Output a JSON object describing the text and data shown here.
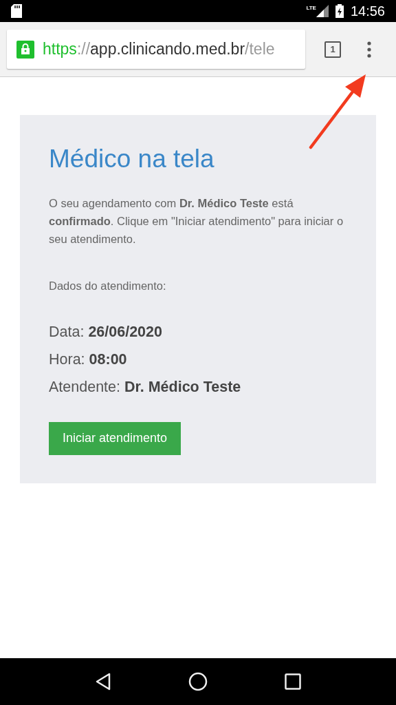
{
  "status_bar": {
    "network": "LTE",
    "time": "14:56"
  },
  "browser": {
    "url": {
      "scheme": "https",
      "separator": "://",
      "host": "app.clinicando.med.br",
      "path": "/tele"
    },
    "tab_count": "1"
  },
  "card": {
    "title": "Médico na tela",
    "message": "O seu agendamento com **Dr. Médico Teste** está **confirmado**. Clique em \"Iniciar atendimento\" para iniciar o seu atendimento.",
    "details_heading": "Dados do atendimento:",
    "details": [
      {
        "label": "Data:",
        "value": "26/06/2020"
      },
      {
        "label": "Hora:",
        "value": "08:00"
      },
      {
        "label": "Atendente:",
        "value": "Dr. Médico Teste"
      }
    ],
    "button": "Iniciar atendimento"
  }
}
